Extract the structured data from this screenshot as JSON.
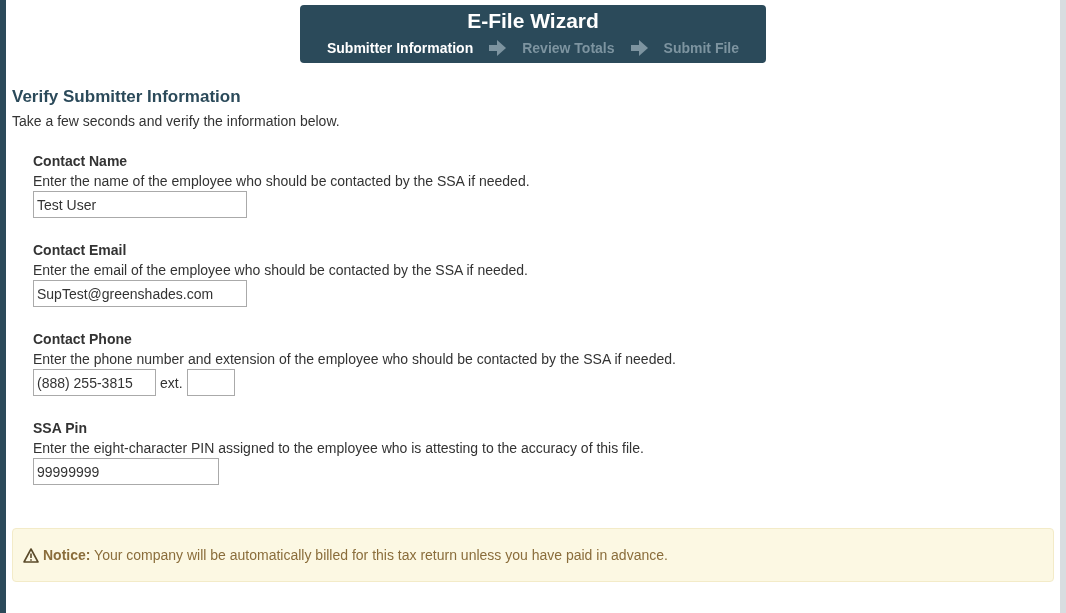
{
  "wizard": {
    "title": "E-File Wizard",
    "steps": [
      {
        "label": "Submitter Information",
        "selected": true
      },
      {
        "label": "Review Totals",
        "selected": false
      },
      {
        "label": "Submit File",
        "selected": false
      }
    ]
  },
  "heading": "Verify Submitter Information",
  "intro": "Take a few seconds and verify the information below.",
  "fields": [
    {
      "kind": "text",
      "label": "Contact Name",
      "help": "Enter the name of the employee who should be contacted by the SSA if needed.",
      "value": "Test User"
    },
    {
      "kind": "text",
      "label": "Contact Email",
      "help": "Enter the email of the employee who should be contacted by the SSA if needed.",
      "value": "SupTest@greenshades.com"
    },
    {
      "kind": "phone",
      "label": "Contact Phone",
      "help": "Enter the phone number and extension of the employee who should be contacted by the SSA if needed.",
      "value": "(888) 255-3815",
      "ext_label": "ext."
    },
    {
      "kind": "pin",
      "label": "SSA Pin",
      "help": "Enter the eight-character PIN assigned to the employee who is attesting to the accuracy of this file.",
      "value": "99999999"
    }
  ],
  "notice": "**Notice:** Your company will be automatically billed for this tax return unless you have paid in advance."
}
